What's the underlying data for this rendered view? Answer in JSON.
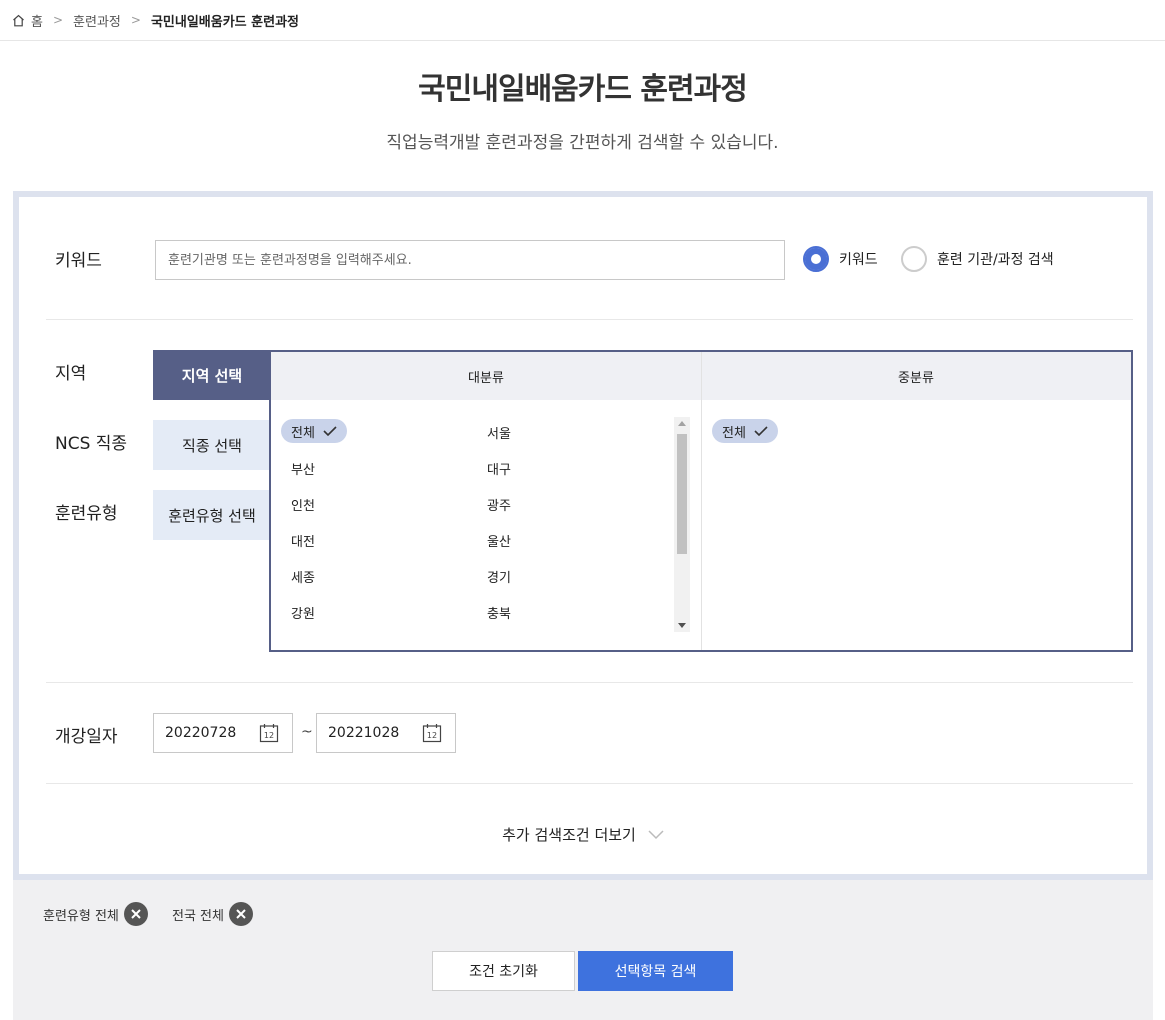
{
  "breadcrumb": {
    "home": "홈",
    "items": [
      "훈련과정",
      "국민내일배움카드 훈련과정"
    ]
  },
  "header": {
    "title": "국민내일배움카드 훈련과정",
    "subtitle": "직업능력개발 훈련과정을 간편하게 검색할 수 있습니다."
  },
  "keyword": {
    "label": "키워드",
    "placeholder": "훈련기관명 또는 훈련과정명을 입력해주세요.",
    "value": "",
    "options": [
      {
        "label": "키워드",
        "selected": true
      },
      {
        "label": "훈련 기관/과정 검색",
        "selected": false
      }
    ]
  },
  "filters": {
    "labels": {
      "region": "지역",
      "ncs": "NCS 직종",
      "training_type": "훈련유형"
    },
    "tabs": {
      "region": "지역 선택",
      "ncs": "직종 선택",
      "training_type": "훈련유형 선택"
    },
    "active_tab": "region"
  },
  "region_selector": {
    "major_header": "대분류",
    "minor_header": "중분류",
    "major_items": [
      "전체",
      "서울",
      "부산",
      "대구",
      "인천",
      "광주",
      "대전",
      "울산",
      "세종",
      "경기",
      "강원",
      "충북"
    ],
    "major_selected": "전체",
    "minor_items": [
      "전체"
    ],
    "minor_selected": "전체"
  },
  "dates": {
    "label": "개강일자",
    "start": "20220728",
    "separator": "~",
    "end": "20221028",
    "calendar_icon_text": "12"
  },
  "more_conditions": "추가 검색조건 더보기",
  "selected_filters": [
    "훈련유형 전체",
    "전국 전체"
  ],
  "actions": {
    "reset": "조건 초기화",
    "search": "선택항목 검색"
  },
  "colors": {
    "accent_blue": "#3e72de",
    "tab_active": "#565f87",
    "tab_inactive": "#e4ebf6",
    "chip": "#c9d3ea",
    "frame": "#dde2ee"
  },
  "icons": [
    "home-icon",
    "chevron-right-icon",
    "check-icon",
    "calendar-icon",
    "chevron-down-icon",
    "close-icon"
  ]
}
